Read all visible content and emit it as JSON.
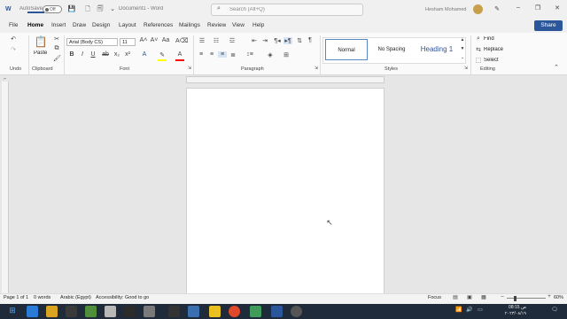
{
  "titlebar": {
    "autosave_label": "AutoSave",
    "autosave_state": "Off",
    "doc_title": "Document1 - Word",
    "search_placeholder": "Search (Alt+Q)",
    "user_name": "Hesham Mohamed"
  },
  "tabs": [
    "File",
    "Home",
    "Insert",
    "Draw",
    "Design",
    "Layout",
    "References",
    "Mailings",
    "Review",
    "View",
    "Help"
  ],
  "share_label": "Share",
  "ribbon": {
    "clipboard": {
      "paste_label": "Paste",
      "group_label": "Clipboard"
    },
    "undo": {
      "group_label": "Undo"
    },
    "font": {
      "font_name": "Arial (Body CS)",
      "font_size": "11",
      "group_label": "Font"
    },
    "paragraph": {
      "group_label": "Paragraph"
    },
    "styles": {
      "items": [
        "Normal",
        "No Spacing",
        "Heading 1"
      ],
      "group_label": "Styles"
    },
    "editing": {
      "find": "Find",
      "replace": "Replace",
      "select": "Select",
      "group_label": "Editing"
    }
  },
  "status": {
    "page": "Page 1 of 1",
    "words": "0 words",
    "language": "Arabic (Egypt)",
    "accessibility": "Accessibility: Good to go",
    "focus": "Focus",
    "zoom": "60%"
  },
  "taskbar": {
    "time": "08:15 ص",
    "date": "٢٠٢٣/٠٨/١٩"
  },
  "colors": {
    "accent": "#2b579a",
    "highlight": "#ffff00",
    "font_color": "#ff0000"
  }
}
